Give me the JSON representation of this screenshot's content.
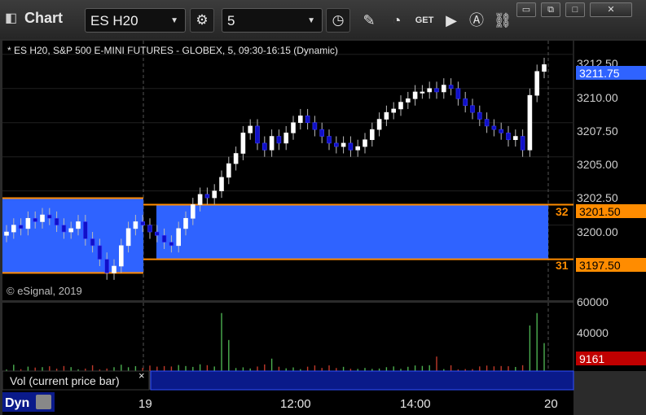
{
  "toolbar": {
    "title": "Chart",
    "symbol": "ES H20",
    "interval": "5",
    "icons": [
      "settings-gear-icon",
      "clock-icon",
      "pencil-draw-icon",
      "line-chart-icon",
      "get-icon",
      "play-icon",
      "alert-icon",
      "link-icon"
    ],
    "get_label": "GET"
  },
  "window_buttons": [
    "pin-icon",
    "restore-icon",
    "maximize-icon",
    "close-icon"
  ],
  "chart_info": "* ES H20, S&P 500 E-MINI FUTURES - GLOBEX, 5, 09:30-16:15 (Dynamic)",
  "copyright": "© eSignal, 2019",
  "price_axis": {
    "ticks": [
      "3212.50",
      "3210.00",
      "3207.50",
      "3205.00",
      "3202.50",
      "3200.00"
    ],
    "last_price": "3211.75",
    "upper_level": "3201.50",
    "lower_level": "3197.50",
    "upper_level_num": "32",
    "lower_level_num": "31"
  },
  "volume_axis": {
    "ticks": [
      "60000",
      "40000"
    ],
    "current": "9161"
  },
  "volume_panel_label": "Vol (current price bar)",
  "volume_close": "×",
  "time_axis": {
    "ticks": [
      "19",
      "12:00",
      "14:00",
      "20"
    ]
  },
  "status": {
    "mode": "Dyn"
  },
  "colors": {
    "background": "#000000",
    "up_candle": "#ffffff",
    "down_candle": "#1010c8",
    "zone": "#2f63ff",
    "zone_border": "#ff8c00",
    "volume_up": "#4caf50",
    "volume_down": "#c0392b",
    "last_price_bg": "#2f63ff",
    "volume_current_bg": "#c00000"
  },
  "chart_data": {
    "type": "candlestick",
    "session_marker_times": [
      "19",
      "20"
    ],
    "price_range": [
      3194.5,
      3213.5
    ],
    "levels": [
      {
        "label": "32",
        "price": 3201.5
      },
      {
        "label": "31",
        "price": 3197.5
      }
    ],
    "last_price": 3211.75,
    "closes": [
      3199.5,
      3200.0,
      3199.75,
      3200.5,
      3200.25,
      3200.75,
      3200.5,
      3200.0,
      3199.5,
      3199.75,
      3200.25,
      3199.0,
      3198.5,
      3197.5,
      3196.5,
      3197.0,
      3198.5,
      3199.75,
      3200.25,
      3200.0,
      3199.5,
      3199.25,
      3198.75,
      3198.5,
      3199.75,
      3200.5,
      3201.5,
      3202.25,
      3202.0,
      3202.5,
      3203.5,
      3204.5,
      3205.25,
      3206.75,
      3207.25,
      3206.0,
      3205.5,
      3206.5,
      3206.0,
      3206.75,
      3207.5,
      3208.0,
      3207.5,
      3207.0,
      3206.5,
      3206.0,
      3205.75,
      3206.0,
      3205.5,
      3205.75,
      3206.25,
      3207.0,
      3207.75,
      3208.25,
      3208.5,
      3209.0,
      3209.25,
      3209.75,
      3209.75,
      3210.0,
      3209.75,
      3210.25,
      3210.0,
      3209.25,
      3208.75,
      3208.25,
      3207.75,
      3207.25,
      3207.0,
      3206.75,
      3206.25,
      3206.5,
      3205.5,
      3209.5,
      3211.25,
      3211.75
    ],
    "volume_max": 60000,
    "volume_ticks": [
      60000,
      40000
    ],
    "volume_current": 9161
  }
}
